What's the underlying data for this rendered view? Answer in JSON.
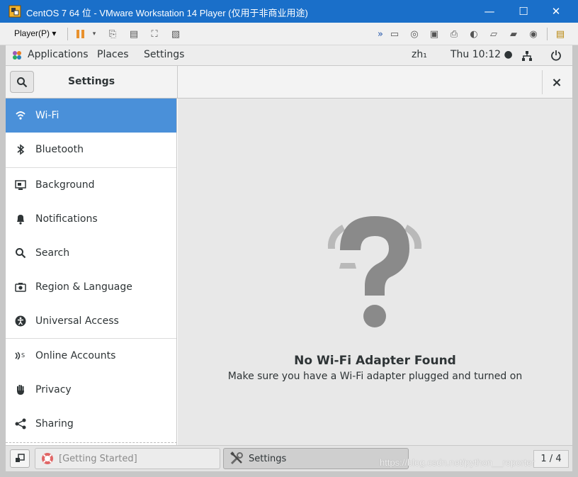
{
  "vmware": {
    "window_title": "CentOS 7 64 位 - VMware Workstation 14 Player (仅用于非商业用途)",
    "player_menu": "Player(P)",
    "minimize": "—",
    "maximize": "☐",
    "close": "✕"
  },
  "gnome": {
    "applications": "Applications",
    "places": "Places",
    "settings_menu": "Settings",
    "input_method": "zh₁",
    "clock": "Thu 10:12 ●"
  },
  "settings": {
    "title": "Settings",
    "close": "×",
    "sidebar": [
      {
        "label": "Wi-Fi",
        "icon": "wifi-icon"
      },
      {
        "label": "Bluetooth",
        "icon": "bluetooth-icon"
      },
      {
        "label": "Background",
        "icon": "background-icon"
      },
      {
        "label": "Notifications",
        "icon": "bell-icon"
      },
      {
        "label": "Search",
        "icon": "search-icon"
      },
      {
        "label": "Region & Language",
        "icon": "camera-icon"
      },
      {
        "label": "Universal Access",
        "icon": "accessibility-icon"
      },
      {
        "label": "Online Accounts",
        "icon": "online-accounts-icon"
      },
      {
        "label": "Privacy",
        "icon": "hand-icon"
      },
      {
        "label": "Sharing",
        "icon": "share-icon"
      }
    ],
    "empty_title": "No Wi-Fi Adapter Found",
    "empty_subtitle": "Make sure you have a Wi-Fi adapter plugged and turned on"
  },
  "taskbar": {
    "task1": "[Getting Started]",
    "task2": "Settings",
    "workspace": "1 / 4"
  },
  "watermark": "https://blog.csdn.net/python__reporter",
  "colors": {
    "accent": "#4a90d9",
    "vmware_title": "#1a6fc9"
  }
}
